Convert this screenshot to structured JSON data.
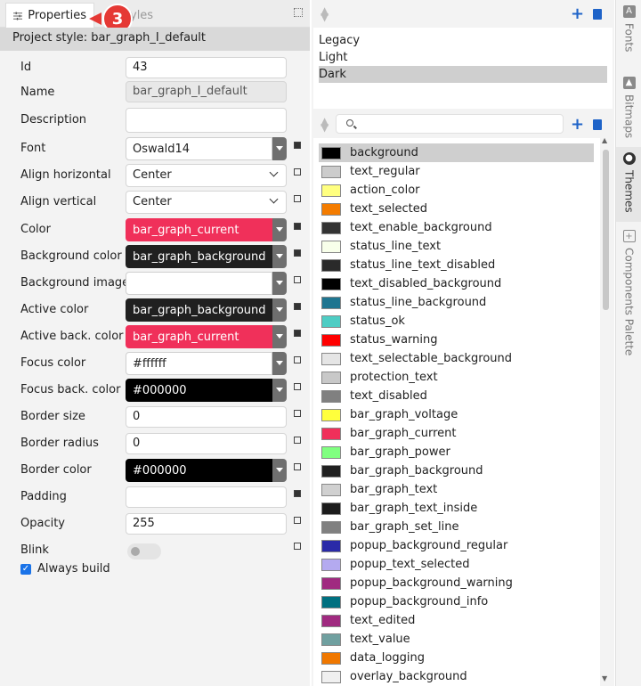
{
  "tabs": {
    "properties": "Properties",
    "styles_partial": "yles"
  },
  "badge": "3",
  "style_header": "Project style: bar_graph_I_default",
  "fields": {
    "id_label": "Id",
    "id_value": "43",
    "name_label": "Name",
    "name_value": "bar_graph_I_default",
    "name_button": "...",
    "description_label": "Description",
    "description_value": "",
    "font_label": "Font",
    "font_value": "Oswald14",
    "align_h_label": "Align horizontal",
    "align_h_value": "Center",
    "align_v_label": "Align vertical",
    "align_v_value": "Center",
    "color_label": "Color",
    "color_value": "bar_graph_current",
    "bg_color_label": "Background color",
    "bg_color_value": "bar_graph_background",
    "bg_image_label": "Background image",
    "bg_image_value": "",
    "active_color_label": "Active color",
    "active_color_value": "bar_graph_background",
    "active_back_label": "Active back. color",
    "active_back_value": "bar_graph_current",
    "focus_color_label": "Focus color",
    "focus_color_value": "#ffffff",
    "focus_back_label": "Focus back. color",
    "focus_back_value": "#000000",
    "border_size_label": "Border size",
    "border_size_value": "0",
    "border_radius_label": "Border radius",
    "border_radius_value": "0",
    "border_color_label": "Border color",
    "border_color_value": "#000000",
    "padding_label": "Padding",
    "padding_value": "",
    "opacity_label": "Opacity",
    "opacity_value": "255",
    "blink_label": "Blink",
    "always_build_label": "Always build"
  },
  "themes": [
    "Legacy",
    "Light",
    "Dark"
  ],
  "selected_theme": "Dark",
  "colors": [
    {
      "name": "background",
      "color": "#000000"
    },
    {
      "name": "text_regular",
      "color": "#cccccc"
    },
    {
      "name": "action_color",
      "color": "#ffff80"
    },
    {
      "name": "text_selected",
      "color": "#f47c00"
    },
    {
      "name": "text_enable_background",
      "color": "#333333"
    },
    {
      "name": "status_line_text",
      "color": "#f8ffea"
    },
    {
      "name": "status_line_text_disabled",
      "color": "#2a2a2a"
    },
    {
      "name": "text_disabled_background",
      "color": "#000000"
    },
    {
      "name": "status_line_background",
      "color": "#1e7590"
    },
    {
      "name": "status_ok",
      "color": "#4ecdc4"
    },
    {
      "name": "status_warning",
      "color": "#ff0000"
    },
    {
      "name": "text_selectable_background",
      "color": "#e5e5e5"
    },
    {
      "name": "protection_text",
      "color": "#c8c8c8"
    },
    {
      "name": "text_disabled",
      "color": "#808080"
    },
    {
      "name": "bar_graph_voltage",
      "color": "#ffff3c"
    },
    {
      "name": "bar_graph_current",
      "color": "#f0305a"
    },
    {
      "name": "bar_graph_power",
      "color": "#80ff80"
    },
    {
      "name": "bar_graph_background",
      "color": "#202020"
    },
    {
      "name": "bar_graph_text",
      "color": "#d0d0d0"
    },
    {
      "name": "bar_graph_text_inside",
      "color": "#1c1c1c"
    },
    {
      "name": "bar_graph_set_line",
      "color": "#808080"
    },
    {
      "name": "popup_background_regular",
      "color": "#2a2aa8"
    },
    {
      "name": "popup_text_selected",
      "color": "#b4aaf0"
    },
    {
      "name": "popup_background_warning",
      "color": "#a02a80"
    },
    {
      "name": "popup_background_info",
      "color": "#007080"
    },
    {
      "name": "text_edited",
      "color": "#a02a80"
    },
    {
      "name": "text_value",
      "color": "#70a0a0"
    },
    {
      "name": "data_logging",
      "color": "#f07800"
    },
    {
      "name": "overlay_background",
      "color": "#f0f0f0"
    }
  ],
  "sidebar_tabs": [
    "Fonts",
    "Bitmaps",
    "Themes",
    "Components Palette"
  ],
  "accent_color": "#1e63c8"
}
